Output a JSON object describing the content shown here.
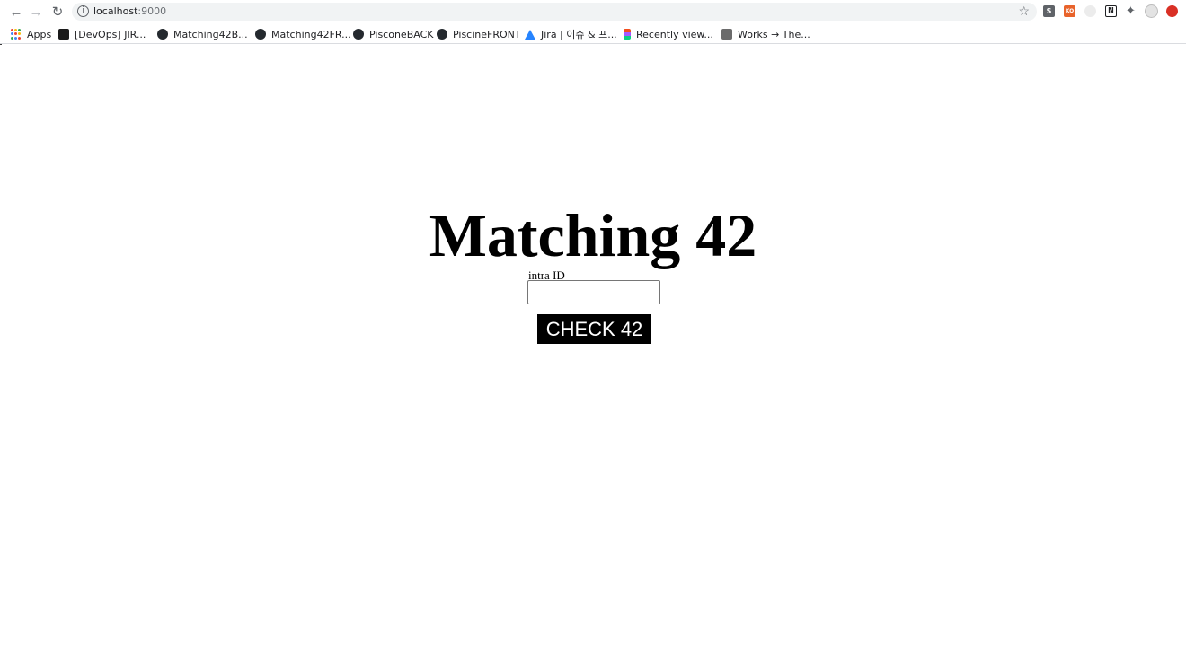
{
  "browser": {
    "url_host": "localhost",
    "url_port": ":9000",
    "extensions": [
      {
        "icon": "s-extension-icon",
        "glyph": "S",
        "color": "#5f6368"
      },
      {
        "icon": "orange-extension-icon",
        "glyph": "KO",
        "color": "#e8632b"
      },
      {
        "icon": "cat-extension-icon",
        "glyph": "",
        "color": "#d6d6d6"
      },
      {
        "icon": "notion-extension-icon",
        "glyph": "N",
        "color": "#202124"
      },
      {
        "icon": "puzzle-extensions-icon",
        "glyph": "",
        "color": "#5f6368"
      },
      {
        "icon": "profile-avatar-icon",
        "glyph": "",
        "color": "#c0c0c0"
      },
      {
        "icon": "red-extension-icon",
        "glyph": "",
        "color": "#d93025"
      }
    ]
  },
  "bookmarks": [
    {
      "label": "Apps",
      "icon": "apps-grid-icon"
    },
    {
      "label": "[DevOps] JIR...",
      "icon": "devops-icon"
    },
    {
      "label": "Matching42B...",
      "icon": "github-icon"
    },
    {
      "label": "Matching42FR...",
      "icon": "github-icon"
    },
    {
      "label": "PisconeBACK",
      "icon": "github-icon"
    },
    {
      "label": "PiscineFRONT",
      "icon": "github-icon"
    },
    {
      "label": "Jira | 이슈 & 프...",
      "icon": "jira-icon"
    },
    {
      "label": "Recently view...",
      "icon": "figma-icon"
    },
    {
      "label": "Works → The...",
      "icon": "notion-icon"
    }
  ],
  "page": {
    "title": "Matching 42",
    "input_label": "intra ID",
    "input_value": "",
    "button_label": "CHECK 42"
  },
  "colors": {
    "button_bg": "#000000",
    "button_text": "#ffffff",
    "jira_blue": "#2684ff"
  }
}
